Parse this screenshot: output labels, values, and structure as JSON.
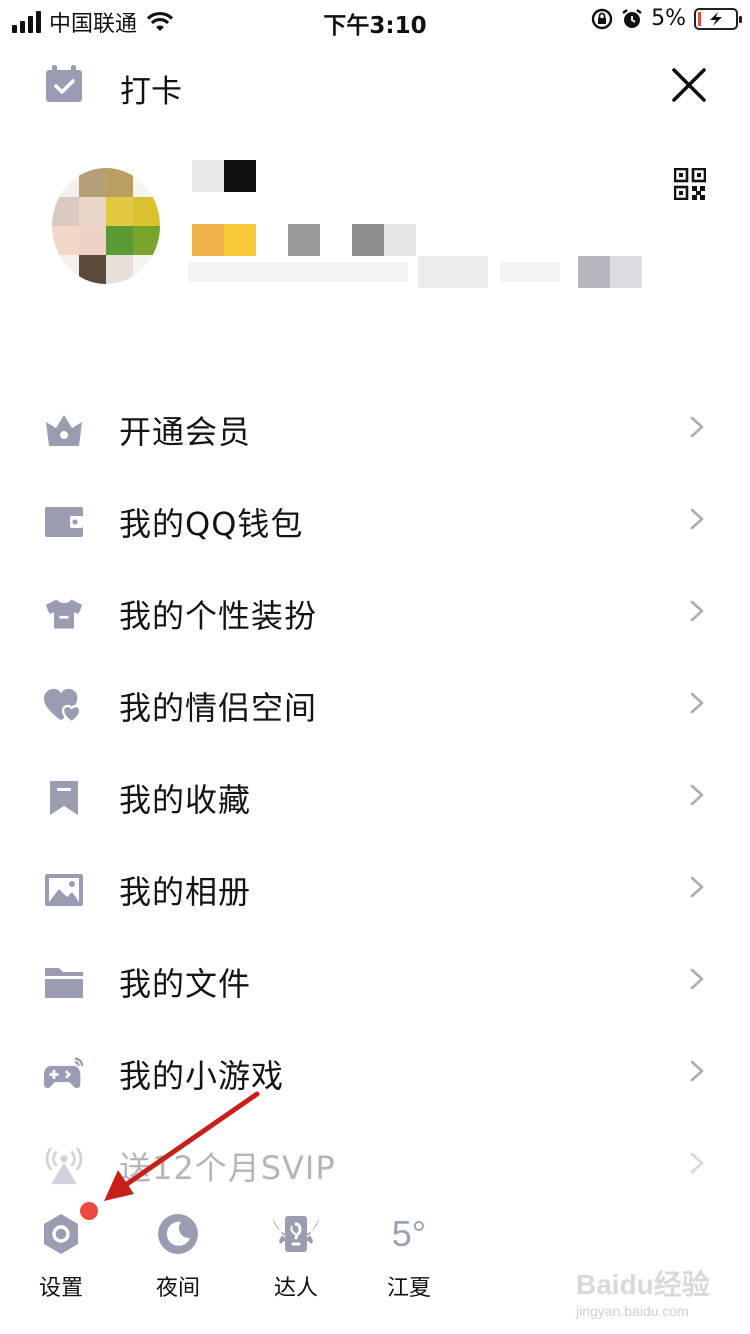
{
  "status_bar": {
    "carrier": "中国联通",
    "time": "下午3:10",
    "battery": "5%"
  },
  "header": {
    "title": "打卡"
  },
  "menu": [
    {
      "label": "开通会员",
      "icon": "crown-icon"
    },
    {
      "label": "我的QQ钱包",
      "icon": "wallet-icon"
    },
    {
      "label": "我的个性装扮",
      "icon": "tshirt-icon"
    },
    {
      "label": "我的情侣空间",
      "icon": "hearts-icon"
    },
    {
      "label": "我的收藏",
      "icon": "bookmark-icon"
    },
    {
      "label": "我的相册",
      "icon": "picture-icon"
    },
    {
      "label": "我的文件",
      "icon": "folder-icon"
    },
    {
      "label": "我的小游戏",
      "icon": "gamepad-icon"
    },
    {
      "label": "送12个月SVIP",
      "icon": "broadcast-icon"
    }
  ],
  "bottom_bar": {
    "settings": "设置",
    "night": "夜间",
    "talent": "达人",
    "weather_temp": "5°",
    "location": "江夏"
  },
  "colors": {
    "icon_gray": "#9a9db2",
    "badge_red": "#f0493f",
    "arrow_red": "#c7201b"
  },
  "watermark": "Baidu经验",
  "watermark_url": "jingyan.baidu.com"
}
